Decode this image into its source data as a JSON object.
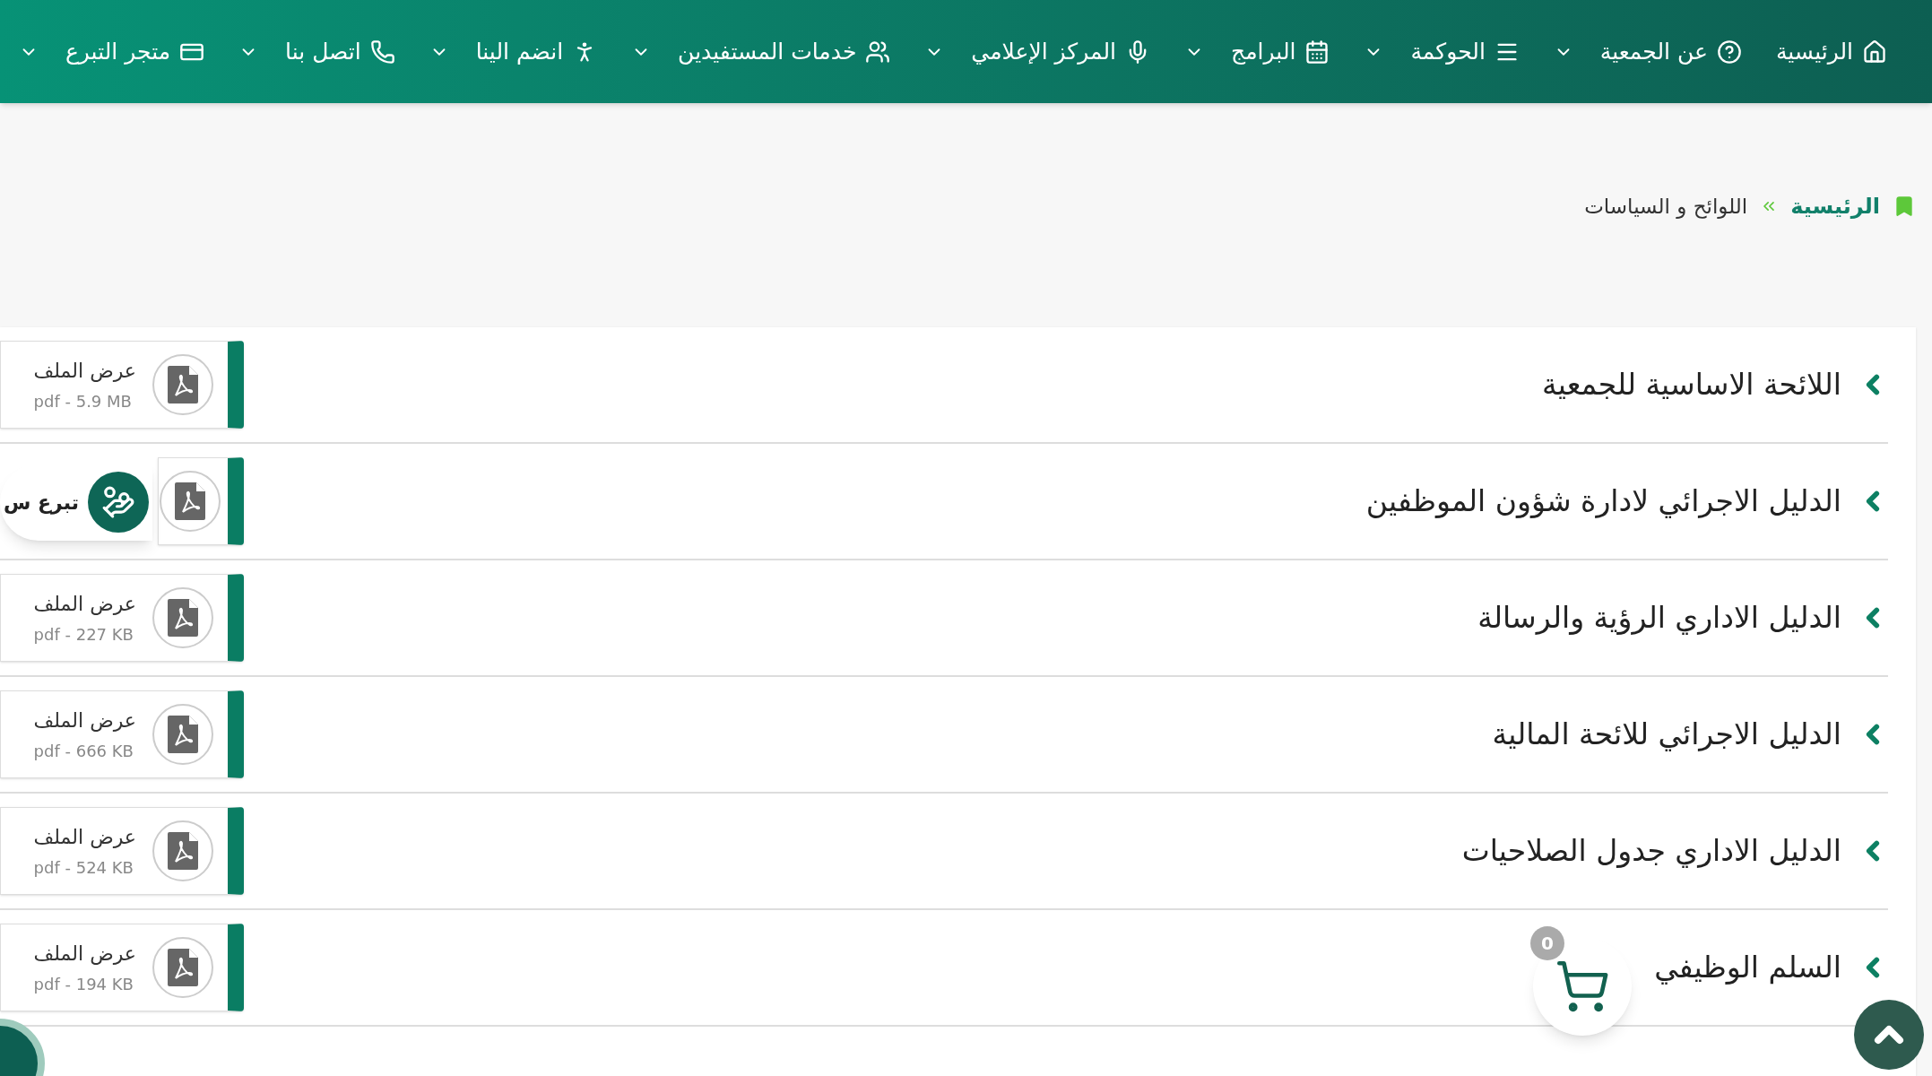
{
  "nav": [
    {
      "label": "الرئيسية",
      "dropdown": false
    },
    {
      "label": "عن الجمعية",
      "dropdown": true
    },
    {
      "label": "الحوكمة",
      "dropdown": true
    },
    {
      "label": "البرامج",
      "dropdown": true
    },
    {
      "label": "المركز الإعلامي",
      "dropdown": true
    },
    {
      "label": "خدمات المستفيدين",
      "dropdown": true
    },
    {
      "label": "انضم الينا",
      "dropdown": true
    },
    {
      "label": "اتصل بنا",
      "dropdown": true
    },
    {
      "label": "متجر التبرع",
      "dropdown": true
    }
  ],
  "breadcrumb": {
    "home": "الرئيسية",
    "current": "اللوائح و السياسات"
  },
  "documents": [
    {
      "title": "اللائحة الاساسية للجمعية",
      "file_label": "عرض الملف",
      "file_meta": "pdf - 5.9 MB"
    },
    {
      "title": "الدليل الاجرائي لادارة شؤون الموظفين"
    },
    {
      "title": "الدليل الاداري الرؤية والرسالة",
      "file_label": "عرض الملف",
      "file_meta": "pdf - 227 KB"
    },
    {
      "title": "الدليل الاجرائي للائحة المالية",
      "file_label": "عرض الملف",
      "file_meta": "pdf - 666 KB"
    },
    {
      "title": "الدليل الاداري جدول الصلاحيات",
      "file_label": "عرض الملف",
      "file_meta": "pdf - 524 KB"
    },
    {
      "title": "السلم الوظيفي",
      "file_label": "عرض الملف",
      "file_meta": "pdf - 194 KB"
    }
  ],
  "donate_button": {
    "label": "تبرع س"
  },
  "cart": {
    "count": "0"
  }
}
